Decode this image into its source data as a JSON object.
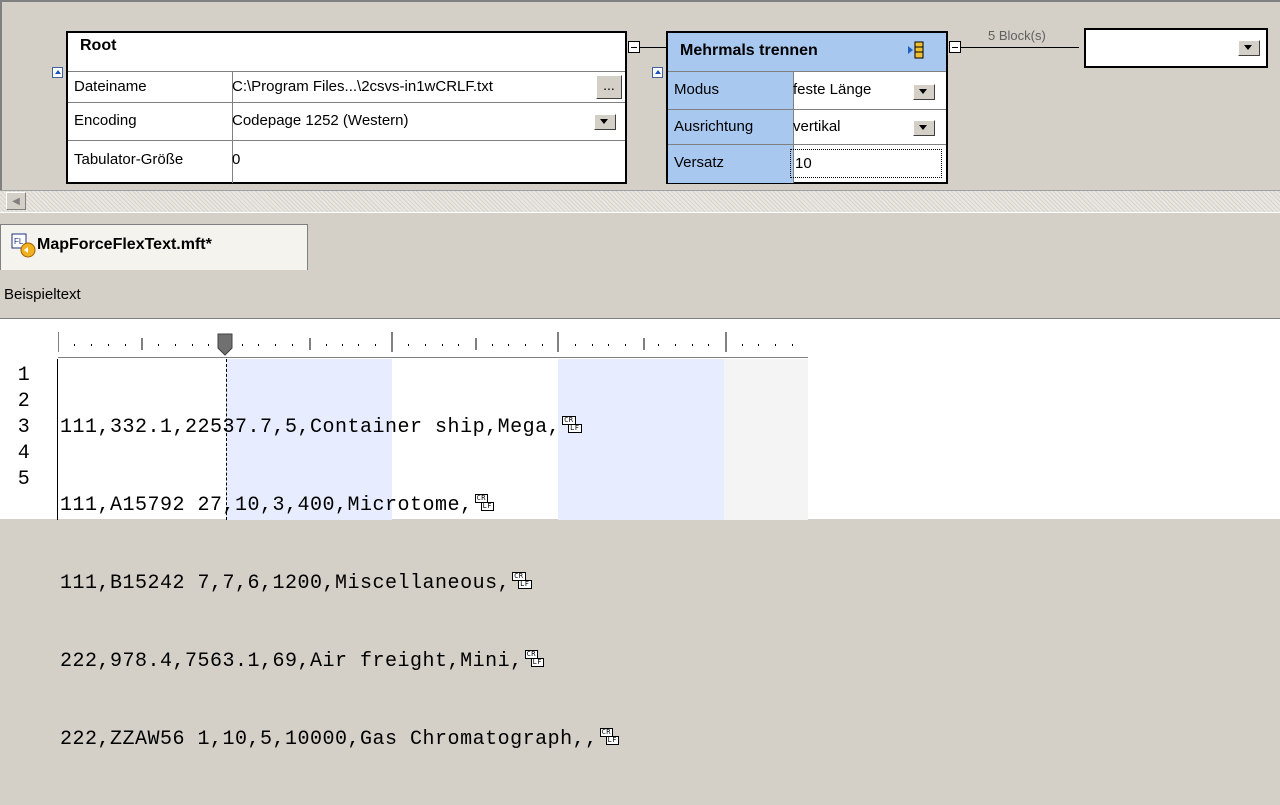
{
  "root": {
    "title": "Root",
    "rows": [
      {
        "label": "Dateiname",
        "value": "C:\\Program Files...\\2csvs-in1wCRLF.txt",
        "button": "..."
      },
      {
        "label": "Encoding",
        "value": "Codepage 1252 (Western)"
      },
      {
        "label": "Tabulator-Größe",
        "value": "0"
      }
    ]
  },
  "split": {
    "title": "Mehrmals trennen",
    "rows": [
      {
        "label": "Modus",
        "value": "feste Länge"
      },
      {
        "label": "Ausrichtung",
        "value": "vertikal"
      },
      {
        "label": "Versatz",
        "value": "10"
      }
    ],
    "connector_label": "5 Block(s)"
  },
  "target": {
    "value": ""
  },
  "tab": {
    "label": "MapForceFlexText.mft*"
  },
  "sample_text_label": "Beispieltext",
  "editor": {
    "line_numbers": [
      "1",
      "2",
      "3",
      "4",
      "5"
    ],
    "lines": [
      "111,332.1,22537.7,5,Container ship,Mega,",
      "111,A15792 27,10,3,400,Microtome,",
      "111,B15242 7,7,6,1200,Miscellaneous,",
      "222,978.4,7563.1,69,Air freight,Mini,",
      "222,ZZAW56 1,10,5,10000,Gas Chromatograph,,"
    ],
    "eol_glyph": "CRLF"
  },
  "colors": {
    "accent_header": "#a8c8f0",
    "label_bg": "#a8c8f0",
    "block_highlight": "#e8ecff"
  }
}
